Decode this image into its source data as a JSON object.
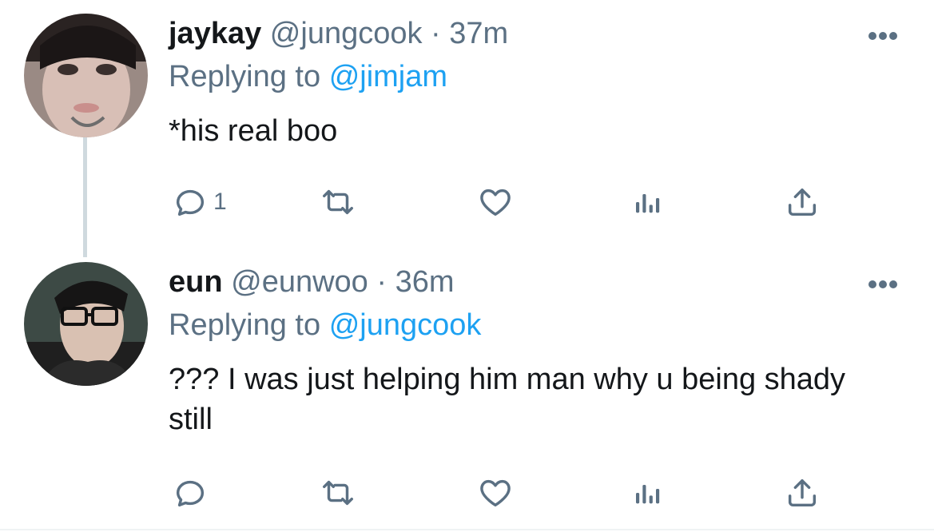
{
  "tweets": [
    {
      "display_name": "jaykay",
      "handle": "@jungcook",
      "separator": "·",
      "time": "37m",
      "replying_prefix": "Replying to",
      "replying_to": "@jimjam",
      "text": "*his real boo",
      "reply_count": "1"
    },
    {
      "display_name": "eun",
      "handle": "@eunwoo",
      "separator": "·",
      "time": "36m",
      "replying_prefix": "Replying to",
      "replying_to": "@jungcook",
      "text": "??? I was just helping him man why u being shady still",
      "reply_count": ""
    }
  ],
  "icons": {
    "reply": "reply-icon",
    "retweet": "retweet-icon",
    "like": "heart-icon",
    "analytics": "analytics-icon",
    "share": "share-icon",
    "more": "more-icon"
  },
  "colors": {
    "link": "#1da1f2",
    "secondary_text": "#5b7083",
    "primary_text": "#14171a",
    "thread_line": "#cfd9de"
  }
}
